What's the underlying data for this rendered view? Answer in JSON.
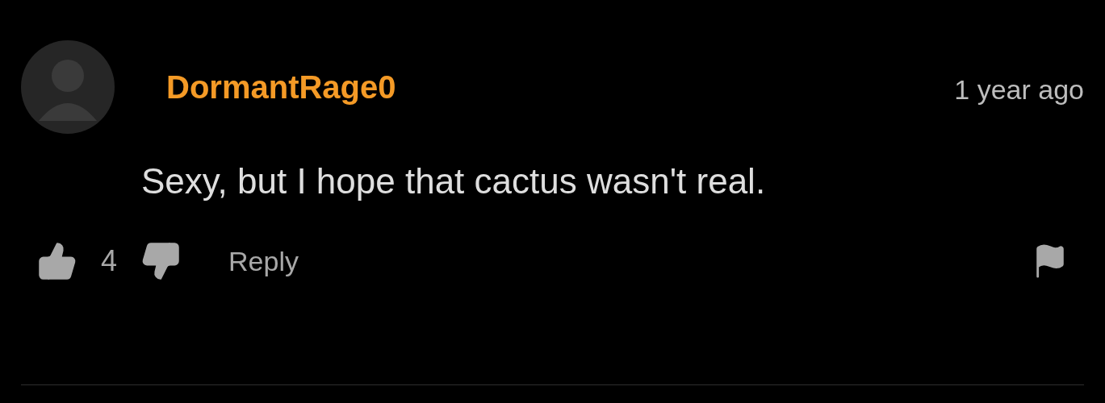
{
  "comment": {
    "username": "DormantRage0",
    "time": "1 year ago",
    "text": "Sexy, but I hope that cactus wasn't real.",
    "likes": "4",
    "reply": "Reply"
  }
}
